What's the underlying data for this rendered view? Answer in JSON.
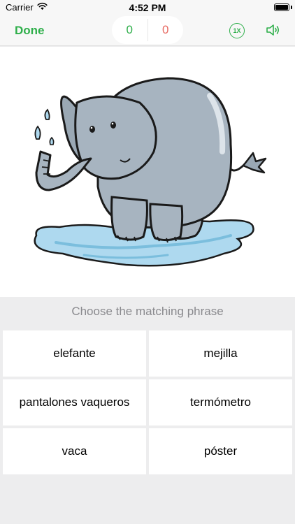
{
  "status_bar": {
    "carrier": "Carrier",
    "time": "4:52 PM"
  },
  "nav": {
    "done_label": "Done",
    "correct_count": "0",
    "wrong_count": "0",
    "speed_label": "1X",
    "sound_icon": "speaker-icon"
  },
  "picture": {
    "subject_icon": "elephant-illustration"
  },
  "quiz": {
    "prompt": "Choose the matching phrase",
    "options": [
      "elefante",
      "mejilla",
      "pantalones vaqueros",
      "termómetro",
      "vaca",
      "póster"
    ]
  },
  "colors": {
    "accent_green": "#2faf4b",
    "wrong_red": "#e86b63",
    "background": "#ededee"
  }
}
